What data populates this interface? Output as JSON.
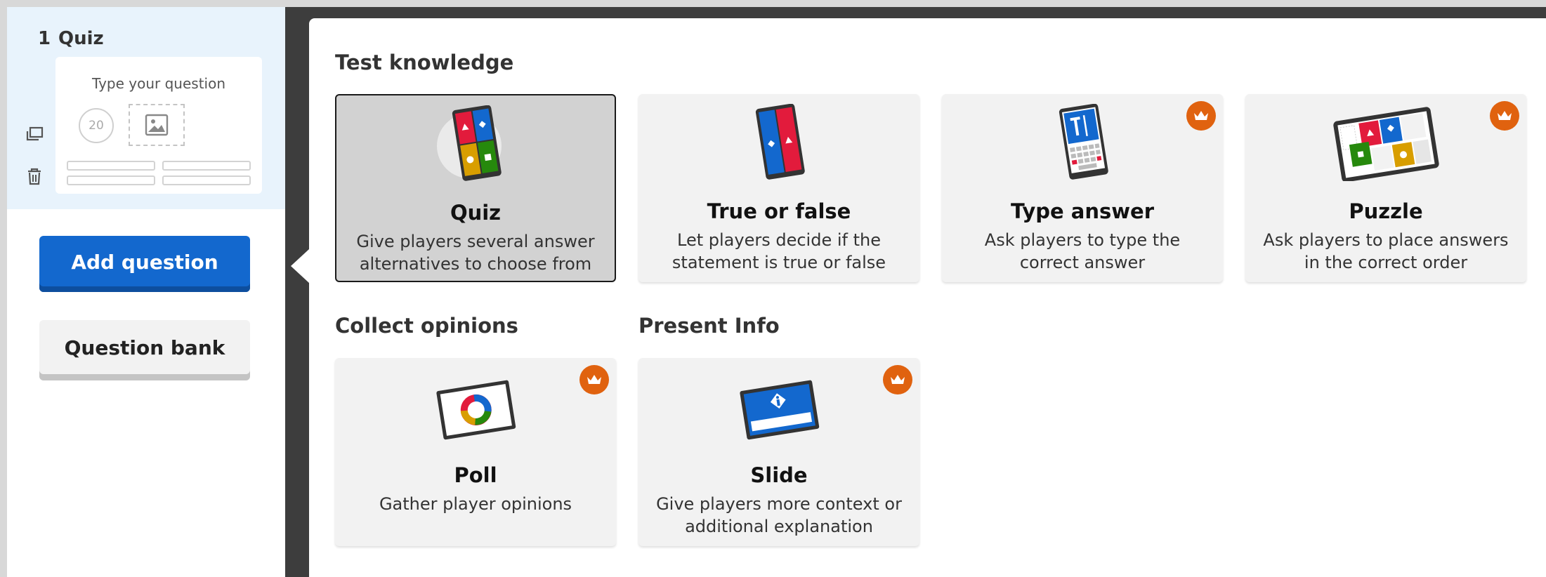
{
  "sidebar": {
    "slide": {
      "number": "1",
      "type": "Quiz",
      "thumbnail_question": "Type your question",
      "thumbnail_timer": "20",
      "duplicate_icon": "duplicate-icon",
      "delete_icon": "trash-icon"
    },
    "add_question_label": "Add question",
    "question_bank_label": "Question bank"
  },
  "main": {
    "sections": {
      "test_knowledge": "Test knowledge",
      "collect_opinions": "Collect opinions",
      "present_info": "Present Info"
    },
    "cards": [
      {
        "title": "Quiz",
        "description": "Give players several answer alternatives to choose from",
        "selected": true,
        "premium": false,
        "icon": "quiz-card-icon"
      },
      {
        "title": "True or false",
        "description": "Let players decide if the statement is true or false",
        "selected": false,
        "premium": false,
        "icon": "true-false-card-icon"
      },
      {
        "title": "Type answer",
        "description": "Ask players to type the correct answer",
        "selected": false,
        "premium": true,
        "icon": "type-answer-card-icon"
      },
      {
        "title": "Puzzle",
        "description": "Ask players to place answers in the correct order",
        "selected": false,
        "premium": true,
        "icon": "puzzle-card-icon"
      },
      {
        "title": "Poll",
        "description": "Gather player opinions",
        "selected": false,
        "premium": true,
        "icon": "poll-card-icon"
      },
      {
        "title": "Slide",
        "description": "Give players more context or additional explanation",
        "selected": false,
        "premium": true,
        "icon": "slide-card-icon"
      }
    ]
  },
  "colors": {
    "red": "#e21b3c",
    "blue": "#1368ce",
    "yellow": "#d89e00",
    "green": "#26890c",
    "premium_orange": "#e0620f"
  }
}
